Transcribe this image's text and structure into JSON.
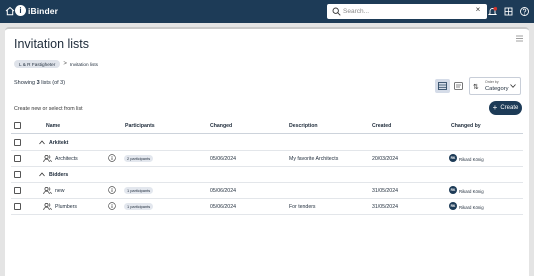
{
  "app": {
    "brand_mark": "i",
    "brand_name": "iBinder"
  },
  "search": {
    "placeholder": "Search...",
    "clear_label": "×"
  },
  "page": {
    "title": "Invitation lists",
    "breadcrumb": {
      "project": "L & R Fastigheter",
      "separator": ">",
      "current": "Invitation lists"
    },
    "showing_prefix": "Showing",
    "showing_count": "3",
    "showing_suffix": "lists (of 3)",
    "order_by": {
      "label": "Order by",
      "value": "Category"
    },
    "create_hint": "Create new or select from list",
    "create_button": "Create"
  },
  "table": {
    "columns": {
      "name": "Name",
      "participants": "Participants",
      "changed": "Changed",
      "description": "Description",
      "created": "Created",
      "changed_by": "Changed by"
    },
    "groups": [
      {
        "title": "Arkitekt",
        "rows": [
          {
            "name": "Architects",
            "participants": "2 participants",
            "changed": "05/06/2024",
            "description": "My favorite Architects",
            "created": "20/03/2024",
            "avatar": "RK",
            "changed_by": "Rikard König"
          }
        ]
      },
      {
        "title": "Bidders",
        "rows": [
          {
            "name": "new",
            "participants": "1 participants",
            "changed": "05/06/2024",
            "description": "",
            "created": "31/05/2024",
            "avatar": "RK",
            "changed_by": "Rikard König"
          },
          {
            "name": "Plumbers",
            "participants": "1 participants",
            "changed": "05/06/2024",
            "description": "For tenders",
            "created": "31/05/2024",
            "avatar": "RK",
            "changed_by": "Rikard König"
          }
        ]
      }
    ]
  },
  "colors": {
    "navy": "#1d3b57",
    "pill": "#e3e7ee",
    "notification": "#d0342c"
  }
}
